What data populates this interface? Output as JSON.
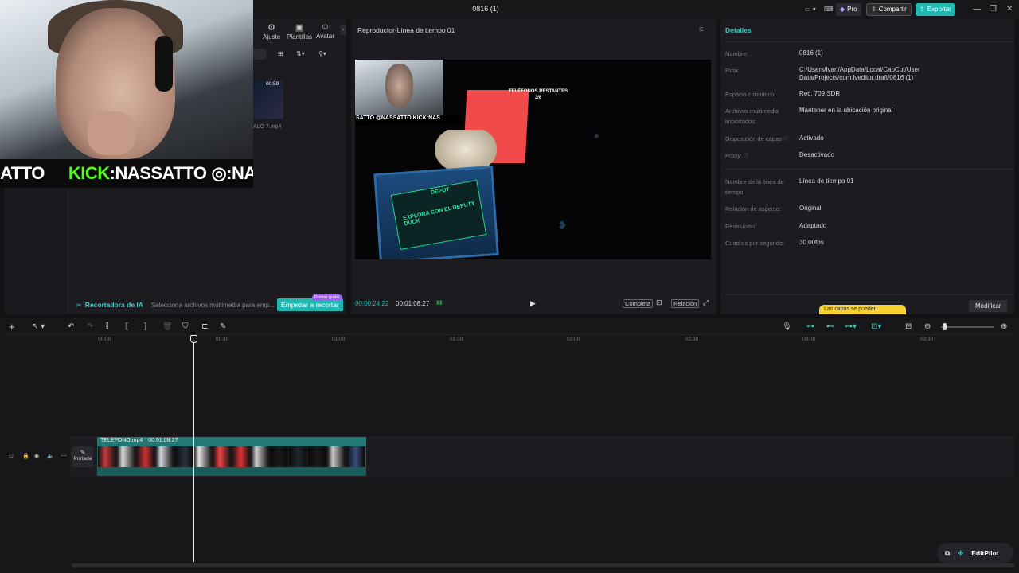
{
  "window": {
    "title": "0816 (1)"
  },
  "topbar": {
    "pro": "Pro",
    "share": "Compartir",
    "export": "Exportar"
  },
  "webcam": {
    "strip_left": "ATTO",
    "strip_kick": "KICK",
    "strip_mid": ":NASSATTO",
    "strip_right": ":NASS"
  },
  "media": {
    "tabs": [
      {
        "label": "Ajuste",
        "icon": "adjust-icon"
      },
      {
        "label": "Plantillas",
        "icon": "templates-icon"
      },
      {
        "label": "Avatar",
        "icon": "avatar-icon"
      }
    ],
    "thumb_time": "00:59",
    "thumb_name": "ALO 7.mp4",
    "ai_cutter": "Recortadora de IA",
    "ai_hint": "Selecciona archivos multimedia para emp...",
    "start_button": "Empezar a recortar",
    "try_badge": "Probar gratis"
  },
  "player": {
    "title": "Reproductor-Línea de tiempo 01",
    "overlay_strip": "SATTO @NASSATTO KICK:NAS",
    "phones_text": "TELÉFONOS RESTANTES",
    "phones_count": "3/6",
    "screen_text": "EXPLORA CON EL DEPUTY DUCK",
    "screen_header": "DEPUT",
    "current_time": "00:00:24:22",
    "total_time": "00:01:08:27",
    "full_label": "Completa",
    "ratio_label": "Relación"
  },
  "details": {
    "title": "Detalles",
    "rows": [
      {
        "label": "Nombre:",
        "value": "0816 (1)"
      },
      {
        "label": "Ruta:",
        "value": "C:/Users/Ivan/AppData/Local/CapCut/User Data/Projects/com.lveditor.draft/0816 (1)"
      },
      {
        "label": "Espacio cromático:",
        "value": "Rec. 709 SDR"
      },
      {
        "label": "Archivos multimedia importados:",
        "value": "Mantener en la ubicación original"
      },
      {
        "label": "Disposición de capas",
        "value": "Activado"
      },
      {
        "label": "Proxy:",
        "value": "Desactivado"
      },
      {
        "label": "Nombre de la línea de tiempo",
        "value": "Línea de tiempo 01"
      },
      {
        "label": "Relación de aspecto:",
        "value": "Original"
      },
      {
        "label": "Resolución:",
        "value": "Adaptado"
      },
      {
        "label": "Cuadros por segundo:",
        "value": "30.00fps"
      }
    ],
    "modify_button": "Modificar",
    "tooltip": "Las capas se pueden"
  },
  "timeline": {
    "ruler": [
      "00:00",
      "00:30",
      "01:00",
      "01:30",
      "02:00",
      "02:30",
      "03:00",
      "03:30"
    ],
    "clip_name": "TELEFONO.mp4",
    "clip_duration": "00:01:08:27",
    "cover_label": "Portada"
  },
  "editpilot": {
    "label": "EditPilot"
  }
}
